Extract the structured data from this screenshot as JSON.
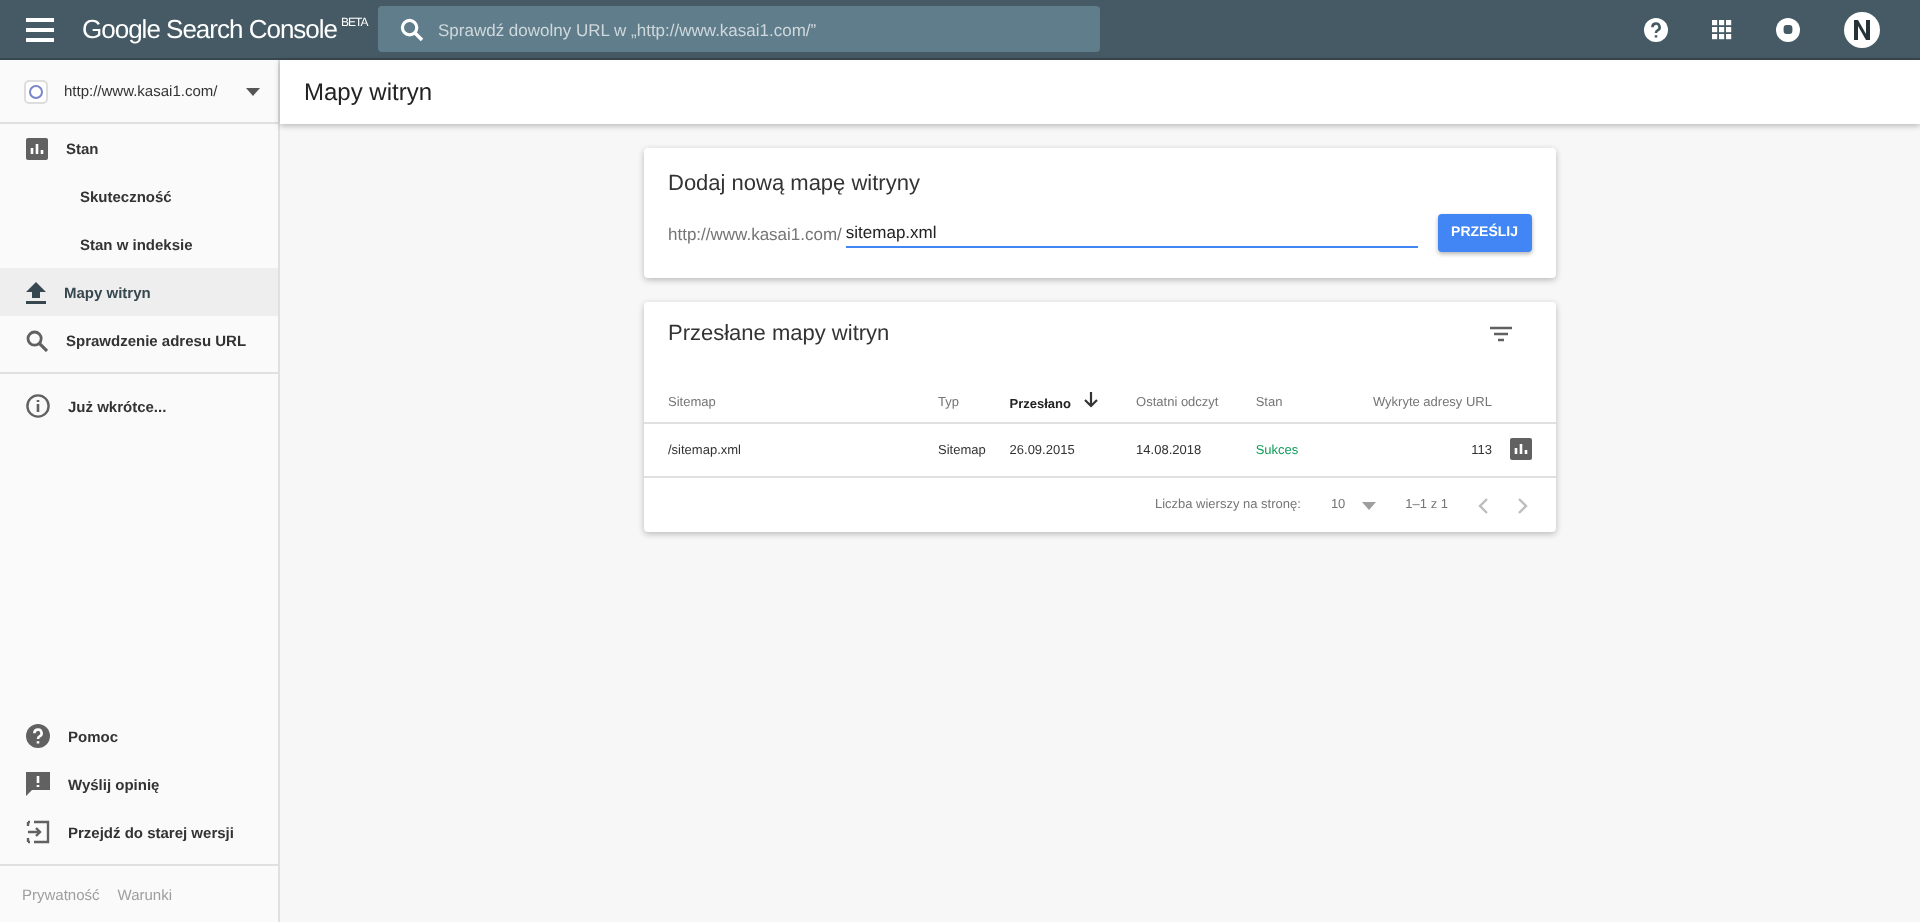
{
  "header": {
    "product": "Google Search Console",
    "badge": "BETA",
    "search": {
      "placeholder": "Sprawdź dowolny URL w „http://www.kasai1.com/”"
    }
  },
  "sidebar": {
    "property": "http://www.kasai1.com/",
    "items": [
      {
        "label": "Stan",
        "kind": "item",
        "selected": false
      },
      {
        "label": "Skuteczność",
        "kind": "sub",
        "selected": false
      },
      {
        "label": "Stan w indeksie",
        "kind": "sub",
        "selected": false
      },
      {
        "label": "Mapy witryn",
        "kind": "item",
        "selected": true
      },
      {
        "label": "Sprawdzenie adresu URL",
        "kind": "item",
        "selected": false
      },
      {
        "label": "Już wkrótce...",
        "kind": "item",
        "selected": false
      }
    ],
    "bottom_items": [
      "Pomoc",
      "Wyślij opinię",
      "Przejdź do starej wersji"
    ],
    "footer_links": [
      "Prywatność",
      "Warunki"
    ]
  },
  "page_title": "Mapy witryn",
  "add_card": {
    "title": "Dodaj nową mapę witryny",
    "prefix": "http://www.kasai1.com/",
    "value": "sitemap.xml",
    "button": "PRZEŚLIJ"
  },
  "table_card": {
    "title": "Przesłane mapy witryn",
    "columns": [
      {
        "label": "Sitemap",
        "sorted": false
      },
      {
        "label": "Typ",
        "sorted": false
      },
      {
        "label": "Przesłano",
        "sorted": true
      },
      {
        "label": "Ostatni odczyt",
        "sorted": false
      },
      {
        "label": "Stan",
        "sorted": false
      },
      {
        "label": "Wykryte adresy URL",
        "sorted": false
      }
    ],
    "rows": [
      {
        "cells": [
          "/sitemap.xml",
          "Sitemap",
          "26.09.2015",
          "14.08.2018",
          "Sukces",
          "113"
        ]
      }
    ],
    "pagination": {
      "label": "Liczba wierszy na stronę:",
      "per_page": "10",
      "range": "1–1 z 1"
    }
  }
}
